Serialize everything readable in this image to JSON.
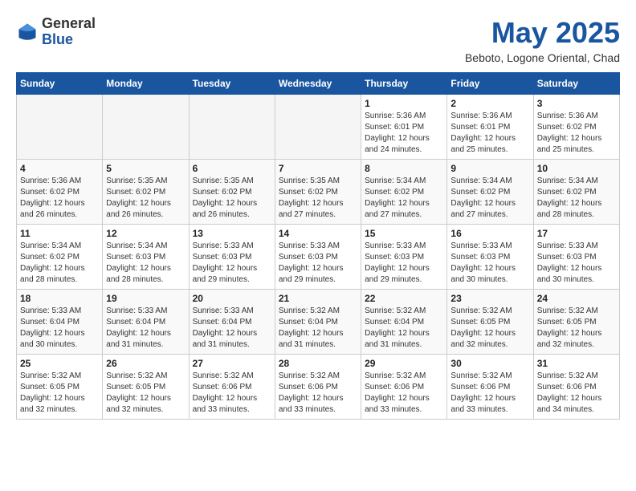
{
  "logo": {
    "general": "General",
    "blue": "Blue"
  },
  "title": {
    "month_year": "May 2025",
    "location": "Beboto, Logone Oriental, Chad"
  },
  "days_of_week": [
    "Sunday",
    "Monday",
    "Tuesday",
    "Wednesday",
    "Thursday",
    "Friday",
    "Saturday"
  ],
  "weeks": [
    [
      {
        "day": "",
        "info": ""
      },
      {
        "day": "",
        "info": ""
      },
      {
        "day": "",
        "info": ""
      },
      {
        "day": "",
        "info": ""
      },
      {
        "day": "1",
        "info": "Sunrise: 5:36 AM\nSunset: 6:01 PM\nDaylight: 12 hours\nand 24 minutes."
      },
      {
        "day": "2",
        "info": "Sunrise: 5:36 AM\nSunset: 6:01 PM\nDaylight: 12 hours\nand 25 minutes."
      },
      {
        "day": "3",
        "info": "Sunrise: 5:36 AM\nSunset: 6:02 PM\nDaylight: 12 hours\nand 25 minutes."
      }
    ],
    [
      {
        "day": "4",
        "info": "Sunrise: 5:36 AM\nSunset: 6:02 PM\nDaylight: 12 hours\nand 26 minutes."
      },
      {
        "day": "5",
        "info": "Sunrise: 5:35 AM\nSunset: 6:02 PM\nDaylight: 12 hours\nand 26 minutes."
      },
      {
        "day": "6",
        "info": "Sunrise: 5:35 AM\nSunset: 6:02 PM\nDaylight: 12 hours\nand 26 minutes."
      },
      {
        "day": "7",
        "info": "Sunrise: 5:35 AM\nSunset: 6:02 PM\nDaylight: 12 hours\nand 27 minutes."
      },
      {
        "day": "8",
        "info": "Sunrise: 5:34 AM\nSunset: 6:02 PM\nDaylight: 12 hours\nand 27 minutes."
      },
      {
        "day": "9",
        "info": "Sunrise: 5:34 AM\nSunset: 6:02 PM\nDaylight: 12 hours\nand 27 minutes."
      },
      {
        "day": "10",
        "info": "Sunrise: 5:34 AM\nSunset: 6:02 PM\nDaylight: 12 hours\nand 28 minutes."
      }
    ],
    [
      {
        "day": "11",
        "info": "Sunrise: 5:34 AM\nSunset: 6:02 PM\nDaylight: 12 hours\nand 28 minutes."
      },
      {
        "day": "12",
        "info": "Sunrise: 5:34 AM\nSunset: 6:03 PM\nDaylight: 12 hours\nand 28 minutes."
      },
      {
        "day": "13",
        "info": "Sunrise: 5:33 AM\nSunset: 6:03 PM\nDaylight: 12 hours\nand 29 minutes."
      },
      {
        "day": "14",
        "info": "Sunrise: 5:33 AM\nSunset: 6:03 PM\nDaylight: 12 hours\nand 29 minutes."
      },
      {
        "day": "15",
        "info": "Sunrise: 5:33 AM\nSunset: 6:03 PM\nDaylight: 12 hours\nand 29 minutes."
      },
      {
        "day": "16",
        "info": "Sunrise: 5:33 AM\nSunset: 6:03 PM\nDaylight: 12 hours\nand 30 minutes."
      },
      {
        "day": "17",
        "info": "Sunrise: 5:33 AM\nSunset: 6:03 PM\nDaylight: 12 hours\nand 30 minutes."
      }
    ],
    [
      {
        "day": "18",
        "info": "Sunrise: 5:33 AM\nSunset: 6:04 PM\nDaylight: 12 hours\nand 30 minutes."
      },
      {
        "day": "19",
        "info": "Sunrise: 5:33 AM\nSunset: 6:04 PM\nDaylight: 12 hours\nand 31 minutes."
      },
      {
        "day": "20",
        "info": "Sunrise: 5:33 AM\nSunset: 6:04 PM\nDaylight: 12 hours\nand 31 minutes."
      },
      {
        "day": "21",
        "info": "Sunrise: 5:32 AM\nSunset: 6:04 PM\nDaylight: 12 hours\nand 31 minutes."
      },
      {
        "day": "22",
        "info": "Sunrise: 5:32 AM\nSunset: 6:04 PM\nDaylight: 12 hours\nand 31 minutes."
      },
      {
        "day": "23",
        "info": "Sunrise: 5:32 AM\nSunset: 6:05 PM\nDaylight: 12 hours\nand 32 minutes."
      },
      {
        "day": "24",
        "info": "Sunrise: 5:32 AM\nSunset: 6:05 PM\nDaylight: 12 hours\nand 32 minutes."
      }
    ],
    [
      {
        "day": "25",
        "info": "Sunrise: 5:32 AM\nSunset: 6:05 PM\nDaylight: 12 hours\nand 32 minutes."
      },
      {
        "day": "26",
        "info": "Sunrise: 5:32 AM\nSunset: 6:05 PM\nDaylight: 12 hours\nand 32 minutes."
      },
      {
        "day": "27",
        "info": "Sunrise: 5:32 AM\nSunset: 6:06 PM\nDaylight: 12 hours\nand 33 minutes."
      },
      {
        "day": "28",
        "info": "Sunrise: 5:32 AM\nSunset: 6:06 PM\nDaylight: 12 hours\nand 33 minutes."
      },
      {
        "day": "29",
        "info": "Sunrise: 5:32 AM\nSunset: 6:06 PM\nDaylight: 12 hours\nand 33 minutes."
      },
      {
        "day": "30",
        "info": "Sunrise: 5:32 AM\nSunset: 6:06 PM\nDaylight: 12 hours\nand 33 minutes."
      },
      {
        "day": "31",
        "info": "Sunrise: 5:32 AM\nSunset: 6:06 PM\nDaylight: 12 hours\nand 34 minutes."
      }
    ]
  ]
}
